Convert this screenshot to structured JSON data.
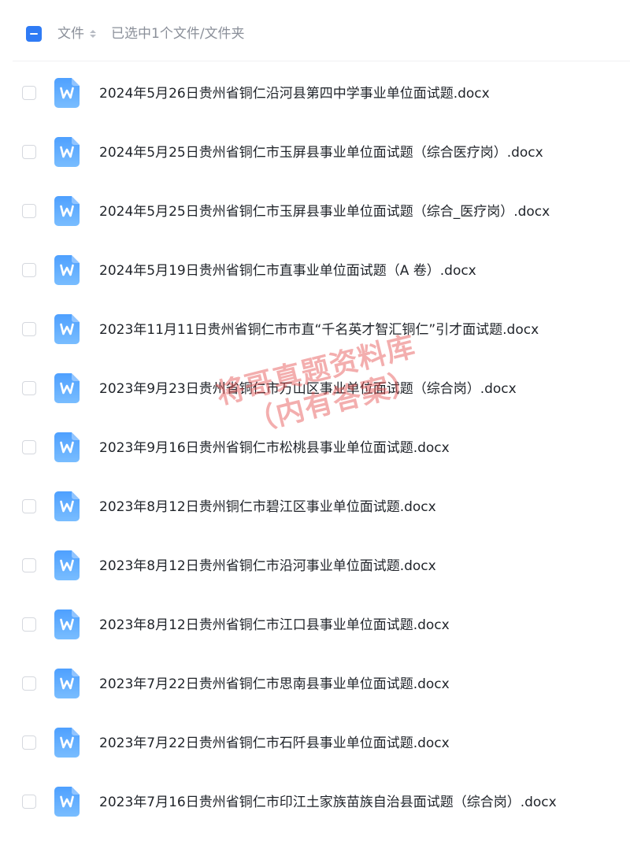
{
  "header": {
    "column_label": "文件",
    "selection_text": "已选中1个文件/文件夹"
  },
  "colors": {
    "accent": "#2f7bf5",
    "word_icon_top": "#4ea0ff",
    "word_icon_bottom": "#79bdff",
    "watermark": "#e44c4c"
  },
  "icons": {
    "file_type": "word-document-icon",
    "sort": "sort-icon"
  },
  "files": [
    {
      "name": "2024年5月26日贵州省铜仁沿河县第四中学事业单位面试题.docx",
      "checked": false
    },
    {
      "name": "2024年5月25日贵州省铜仁市玉屏县事业单位面试题（综合医疗岗）.docx",
      "checked": false
    },
    {
      "name": "2024年5月25日贵州省铜仁市玉屏县事业单位面试题（综合_医疗岗）.docx",
      "checked": false
    },
    {
      "name": "2024年5月19日贵州省铜仁市直事业单位面试题（A 卷）.docx",
      "checked": false
    },
    {
      "name": "2023年11月11日贵州省铜仁市市直“千名英才智汇铜仁”引才面试题.docx",
      "checked": false
    },
    {
      "name": "2023年9月23日贵州省铜仁市万山区事业单位面试题（综合岗）.docx",
      "checked": false
    },
    {
      "name": "2023年9月16日贵州省铜仁市松桃县事业单位面试题.docx",
      "checked": false
    },
    {
      "name": "2023年8月12日贵州铜仁市碧江区事业单位面试题.docx",
      "checked": false
    },
    {
      "name": "2023年8月12日贵州省铜仁市沿河事业单位面试题.docx",
      "checked": false
    },
    {
      "name": "2023年8月12日贵州省铜仁市江口县事业单位面试题.docx",
      "checked": false
    },
    {
      "name": "2023年7月22日贵州省铜仁市思南县事业单位面试题.docx",
      "checked": false
    },
    {
      "name": "2023年7月22日贵州省铜仁市石阡县事业单位面试题.docx",
      "checked": false
    },
    {
      "name": "2023年7月16日贵州省铜仁市印江土家族苗族自治县面试题（综合岗）.docx",
      "checked": false
    }
  ],
  "watermark": {
    "line1": "将哥真题资料库",
    "line2": "（内有答案）"
  }
}
